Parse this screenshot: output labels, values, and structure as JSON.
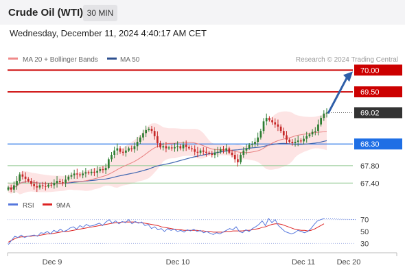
{
  "header": {
    "title": "Crude Oil (WTI)",
    "interval": "30 MIN",
    "datetime": "Wednesday, December 11, 2024 4:40:17 AM CET"
  },
  "legend": {
    "ma20": "MA 20 + Bollinger Bands",
    "ma50": "MA 50",
    "copyright": "Research © 2024 Trading Central"
  },
  "colors": {
    "candle_up": "#2e7d32",
    "candle_down": "#c62828",
    "bollinger_fill": "#fde4e4",
    "ma20": "#e88080",
    "ma50": "#3f66b0",
    "resistance": "#cc0000",
    "support": "#8dc78d",
    "current": "#333333",
    "pivot": "#1f6fe5",
    "arrow": "#2e5ea8",
    "rsi": "#5577dd",
    "rsi_ma": "#dd2222"
  },
  "chart_data": [
    {
      "type": "candlestick",
      "title": "Crude Oil (WTI)",
      "ylim": [
        67.2,
        70.1
      ],
      "x_ticks": [
        "Dec 9",
        "Dec 10",
        "Dec 11",
        "Dec 20"
      ],
      "levels": [
        {
          "label": "70.00",
          "value": 70.0,
          "kind": "resistance"
        },
        {
          "label": "69.50",
          "value": 69.5,
          "kind": "resistance"
        },
        {
          "label": "69.02",
          "value": 69.02,
          "kind": "current"
        },
        {
          "label": "68.30",
          "value": 68.3,
          "kind": "pivot"
        },
        {
          "label": "67.80",
          "value": 67.8,
          "kind": "support"
        },
        {
          "label": "67.40",
          "value": 67.4,
          "kind": "support"
        }
      ],
      "arrow": {
        "from": 69.02,
        "to": 70.0
      },
      "close": [
        67.3,
        67.25,
        67.35,
        67.45,
        67.6,
        67.55,
        67.5,
        67.45,
        67.38,
        67.33,
        67.3,
        67.35,
        67.33,
        67.32,
        67.36,
        67.35,
        67.4,
        67.45,
        67.42,
        67.4,
        67.48,
        67.55,
        67.58,
        67.62,
        67.6,
        67.58,
        67.62,
        67.65,
        67.63,
        67.66,
        67.64,
        67.68,
        67.72,
        67.7,
        67.75,
        67.95,
        68.05,
        68.15,
        68.2,
        68.12,
        68.1,
        68.15,
        68.2,
        68.18,
        68.25,
        68.35,
        68.45,
        68.55,
        68.62,
        68.65,
        68.6,
        68.48,
        68.32,
        68.22,
        68.25,
        68.2,
        68.22,
        68.2,
        68.23,
        68.25,
        68.2,
        68.28,
        68.23,
        68.2,
        68.18,
        68.12,
        68.1,
        68.15,
        68.12,
        68.1,
        68.08,
        68.05,
        68.1,
        68.12,
        68.18,
        68.15,
        68.2,
        68.1,
        68.05,
        67.95,
        67.88,
        68.05,
        68.15,
        68.2,
        68.28,
        68.3,
        68.35,
        68.45,
        68.6,
        68.82,
        68.9,
        68.85,
        68.8,
        68.75,
        68.7,
        68.6,
        68.5,
        68.4,
        68.35,
        68.32,
        68.35,
        68.38,
        68.36,
        68.42,
        68.48,
        68.52,
        68.58,
        68.6,
        68.75,
        68.9,
        69.0,
        69.02
      ]
    },
    {
      "type": "line",
      "title": "RSI",
      "series": [
        {
          "name": "RSI",
          "values": [
            28,
            35,
            42,
            40,
            44,
            40,
            42,
            43,
            44,
            42,
            48,
            47,
            50,
            46,
            52,
            49,
            54,
            50,
            52,
            56,
            58,
            54,
            60,
            57,
            62,
            59,
            60,
            62,
            64,
            60,
            66,
            70,
            64,
            68,
            63,
            67,
            65,
            70,
            63,
            67,
            64,
            66,
            60,
            62,
            55,
            58,
            53,
            55,
            50,
            55,
            52,
            54,
            50,
            52,
            49,
            53,
            51,
            54,
            50,
            52,
            48,
            50,
            47,
            45,
            48,
            46,
            49,
            52,
            55,
            53,
            58,
            50,
            48,
            53,
            50,
            55,
            58,
            62,
            68,
            60,
            72,
            65,
            70,
            60,
            55,
            50,
            48,
            46,
            48,
            52,
            50,
            48,
            50,
            55,
            62,
            68,
            70,
            72
          ]
        },
        {
          "name": "9MA",
          "values": [
            32,
            35,
            38,
            40,
            41,
            41,
            42,
            42,
            43,
            43,
            44,
            45,
            46,
            46,
            47,
            48,
            49,
            50,
            50,
            51,
            52,
            53,
            54,
            55,
            56,
            57,
            58,
            59,
            60,
            61,
            62,
            63,
            64,
            65,
            65,
            66,
            66,
            66,
            66,
            66,
            65,
            65,
            64,
            63,
            62,
            61,
            60,
            58,
            57,
            56,
            55,
            54,
            53,
            53,
            52,
            52,
            52,
            52,
            52,
            51,
            51,
            50,
            50,
            49,
            49,
            49,
            49,
            50,
            50,
            51,
            51,
            51,
            51,
            52,
            52,
            53,
            54,
            55,
            57,
            58,
            60,
            62,
            63,
            63,
            62,
            60,
            58,
            56,
            54,
            53,
            52,
            52,
            51,
            52,
            54,
            57,
            60,
            63
          ]
        }
      ],
      "legend": [
        "RSI",
        "9MA"
      ],
      "ylim": [
        20,
        80
      ],
      "y_ticks": [
        "70",
        "50",
        "30"
      ]
    }
  ]
}
